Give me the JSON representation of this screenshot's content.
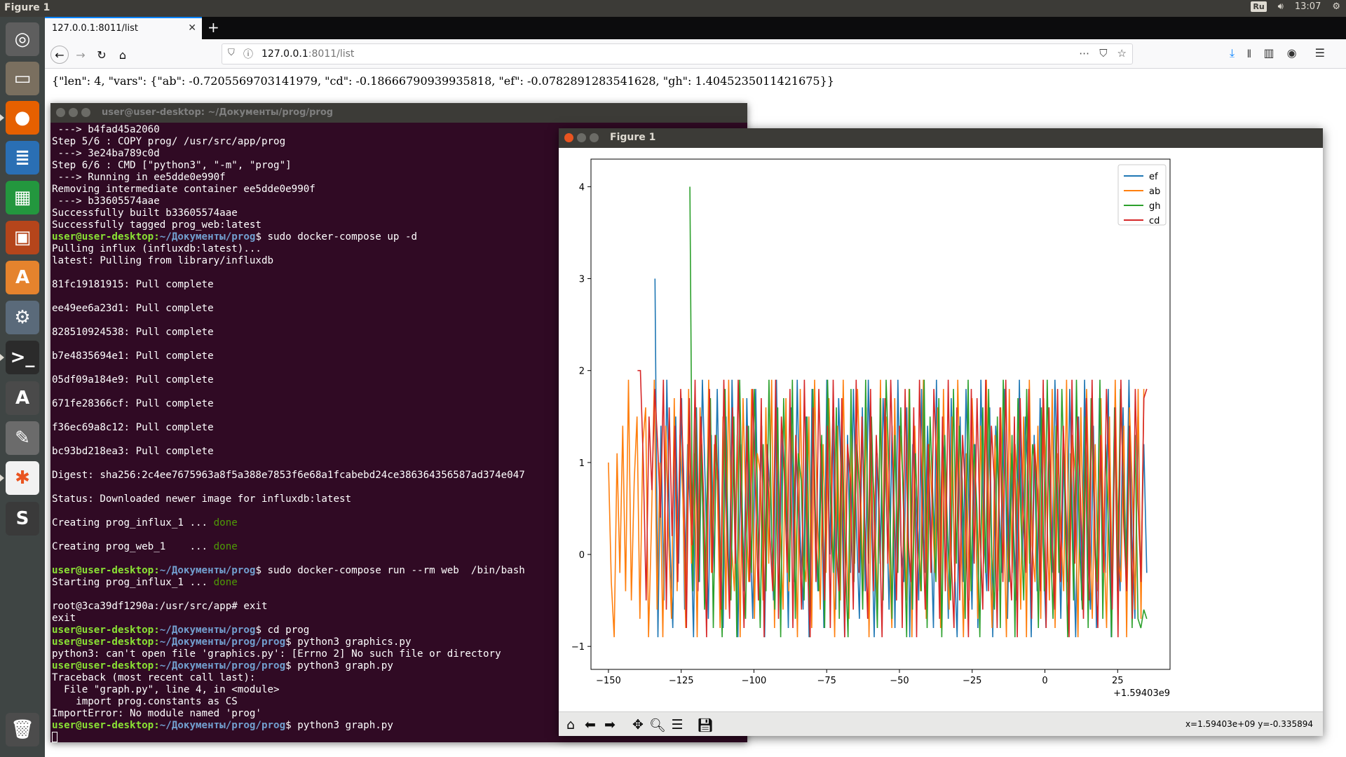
{
  "top_panel": {
    "app_title": "Figure 1",
    "keyboard_layout": "Ru",
    "clock": "13:07"
  },
  "launcher": {
    "items": [
      {
        "name": "ubuntu-dash-icon",
        "color": "#5e5e5e",
        "glyph": "◎"
      },
      {
        "name": "files-icon",
        "color": "#7a6f5f",
        "glyph": "▭"
      },
      {
        "name": "firefox-icon",
        "color": "#e66000",
        "glyph": "●"
      },
      {
        "name": "writer-icon",
        "color": "#2a6fb4",
        "glyph": "≣"
      },
      {
        "name": "calc-icon",
        "color": "#23973e",
        "glyph": "▦"
      },
      {
        "name": "impress-icon",
        "color": "#b5451b",
        "glyph": "▣"
      },
      {
        "name": "software-center-icon",
        "color": "#e5832d",
        "glyph": "A"
      },
      {
        "name": "system-settings-icon",
        "color": "#5a6a7a",
        "glyph": "⚙"
      },
      {
        "name": "terminal-icon",
        "color": "#2b2b2b",
        "glyph": ">_"
      },
      {
        "name": "software-updater-icon",
        "color": "#4a4a4a",
        "glyph": "A"
      },
      {
        "name": "text-editor-icon",
        "color": "#6b6b6b",
        "glyph": "✎"
      },
      {
        "name": "figure-app-icon",
        "color": "#f2f2f2",
        "glyph": "✱"
      },
      {
        "name": "sublime-text-icon",
        "color": "#3a3a3a",
        "glyph": "S"
      },
      {
        "name": "trash-icon",
        "color": "#4c4c4c",
        "glyph": "🗑"
      }
    ]
  },
  "browser": {
    "tab_title": "127.0.0.1:8011/list",
    "url_host": "127.0.0.1",
    "url_path": ":8011/list",
    "page_text": "{\"len\": 4, \"vars\": {\"ab\": -0.7205569703141979, \"cd\": -0.18666790939935818, \"ef\": -0.0782891283541628, \"gh\": 1.4045235011421675}}"
  },
  "terminal": {
    "title": "user@user-desktop: ~/Документы/prog/prog",
    "lines": [
      {
        "t": " ---> b4fad45a2060"
      },
      {
        "t": "Step 5/6 : COPY prog/ /usr/src/app/prog"
      },
      {
        "t": " ---> 3e24ba789c0d"
      },
      {
        "t": "Step 6/6 : CMD [\"python3\", \"-m\", \"prog\"]"
      },
      {
        "t": " ---> Running in ee5dde0e990f"
      },
      {
        "t": "Removing intermediate container ee5dde0e990f"
      },
      {
        "t": " ---> b33605574aae"
      },
      {
        "t": "Successfully built b33605574aae"
      },
      {
        "t": "Successfully tagged prog_web:latest"
      },
      {
        "u": "user@user-desktop",
        "p": "~/Документы/prog",
        "c": "$ sudo docker-compose up -d"
      },
      {
        "t": "Pulling influx (influxdb:latest)..."
      },
      {
        "t": "latest: Pulling from library/influxdb"
      },
      {
        "t": ""
      },
      {
        "t": "81fc19181915: Pull complete"
      },
      {
        "t": ""
      },
      {
        "t": "ee49ee6a23d1: Pull complete"
      },
      {
        "t": ""
      },
      {
        "t": "828510924538: Pull complete"
      },
      {
        "t": ""
      },
      {
        "t": "b7e4835694e1: Pull complete"
      },
      {
        "t": ""
      },
      {
        "t": "05df09a184e9: Pull complete"
      },
      {
        "t": ""
      },
      {
        "t": "671fe28366cf: Pull complete"
      },
      {
        "t": ""
      },
      {
        "t": "f36ec69a8c12: Pull complete"
      },
      {
        "t": ""
      },
      {
        "t": "bc93bd218ea3: Pull complete"
      },
      {
        "t": ""
      },
      {
        "t": "Digest: sha256:2c4ee7675963a8f5a388e7853f6e68a1fcabebd24ce386364356587ad374e047"
      },
      {
        "t": ""
      },
      {
        "t": "Status: Downloaded newer image for influxdb:latest"
      },
      {
        "t": ""
      },
      {
        "t": "Creating prog_influx_1 ... ",
        "d": "done"
      },
      {
        "t": ""
      },
      {
        "t": "Creating prog_web_1    ... ",
        "d": "done"
      },
      {
        "t": ""
      },
      {
        "u": "user@user-desktop",
        "p": "~/Документы/prog",
        "c": "$ sudo docker-compose run --rm web  /bin/bash"
      },
      {
        "t": "Starting prog_influx_1 ... ",
        "d": "done"
      },
      {
        "t": ""
      },
      {
        "t": "root@3ca39df1290a:/usr/src/app# exit"
      },
      {
        "t": "exit"
      },
      {
        "u": "user@user-desktop",
        "p": "~/Документы/prog",
        "c": "$ cd prog"
      },
      {
        "u": "user@user-desktop",
        "p": "~/Документы/prog/prog",
        "c": "$ python3 graphics.py"
      },
      {
        "t": "python3: can't open file 'graphics.py': [Errno 2] No such file or directory"
      },
      {
        "u": "user@user-desktop",
        "p": "~/Документы/prog/prog",
        "c": "$ python3 graph.py"
      },
      {
        "t": "Traceback (most recent call last):"
      },
      {
        "t": "  File \"graph.py\", line 4, in <module>"
      },
      {
        "t": "    import prog.constants as CS"
      },
      {
        "t": "ImportError: No module named 'prog'"
      },
      {
        "u": "user@user-desktop",
        "p": "~/Документы/prog/prog",
        "c": "$ python3 graph.py"
      },
      {
        "cursor": true
      }
    ]
  },
  "figure": {
    "title": "Figure 1",
    "coords_readout": "x=1.59403e+09  y=-0.335894",
    "toolbar": [
      "home-icon",
      "back-icon",
      "forward-icon",
      "pan-icon",
      "zoom-icon",
      "configure-icon",
      "save-icon"
    ]
  },
  "chart_data": {
    "type": "line",
    "xlim": [
      -156,
      43
    ],
    "ylim": [
      -1.25,
      4.3
    ],
    "x_offset_text": "+1.59403e9",
    "xticks": [
      -150,
      -125,
      -100,
      -75,
      -50,
      -25,
      0,
      25
    ],
    "xtick_labels": [
      "−150",
      "−125",
      "−100",
      "−75",
      "−50",
      "−25",
      "0",
      "25"
    ],
    "yticks": [
      -1,
      0,
      1,
      2,
      3,
      4
    ],
    "ytick_labels": [
      "−1",
      "0",
      "1",
      "2",
      "3",
      "4"
    ],
    "legend_position": "top-right",
    "series": [
      {
        "name": "ef",
        "color": "#1f77b4",
        "x_start": -134,
        "x_end": 35,
        "n": 169,
        "values": [
          3.0,
          -0.9,
          1.4,
          -0.5,
          1.9,
          0.2,
          -0.8,
          1.5,
          -0.1,
          1.7,
          -0.6,
          1.2,
          0.4,
          -0.9,
          1.6,
          -0.3,
          1.9,
          0.7,
          -0.7,
          1.3,
          -0.2,
          1.8,
          0.1,
          -0.8,
          1.5,
          -0.5,
          1.9,
          0.5,
          -0.9,
          1.2,
          -0.4,
          1.7,
          0.3,
          -0.7,
          1.8,
          -0.1,
          1.4,
          -0.9,
          1.1,
          0.6,
          -0.5,
          1.9,
          -0.2,
          1.3,
          0.8,
          -0.8,
          1.6,
          -0.3,
          1.9,
          0.2,
          -0.6,
          1.5,
          -0.9,
          1.8,
          0.4,
          -0.4,
          1.2,
          -0.8,
          1.9,
          0.0,
          1.5,
          -0.6,
          1.7,
          0.7,
          -0.9,
          1.3,
          -0.2,
          1.8,
          0.3,
          -0.7,
          1.6,
          -0.4,
          1.9,
          0.5,
          -0.9,
          1.1,
          -0.1,
          1.7,
          0.8,
          -0.6,
          1.4,
          -0.8,
          1.9,
          0.1,
          -0.3,
          1.6,
          -0.9,
          1.2,
          0.6,
          -0.5,
          1.8,
          -0.2,
          1.4,
          0.4,
          -0.8,
          1.9,
          -0.4,
          1.3,
          0.9,
          -0.7,
          1.7,
          0.0,
          -0.9,
          1.5,
          -0.3,
          1.8,
          0.5,
          -0.6,
          1.2,
          -0.8,
          1.9,
          0.2,
          -0.4,
          1.6,
          -0.9,
          1.4,
          0.7,
          -0.2,
          1.8,
          -0.7,
          1.1,
          0.3,
          -0.5,
          1.9,
          -0.1,
          1.5,
          0.8,
          -0.9,
          1.3,
          -0.4,
          1.7,
          0.1,
          -0.8,
          1.6,
          -0.2,
          1.9,
          0.6,
          -0.7,
          1.2,
          -0.3,
          1.8,
          0.4,
          -0.9,
          1.5,
          -0.5,
          1.9,
          0.0,
          -0.6,
          1.4,
          -0.8,
          1.7,
          0.5,
          -0.2,
          1.8,
          -0.9,
          1.3,
          0.7,
          -0.4,
          1.6,
          -0.1,
          1.9,
          0.2,
          -0.7,
          1.5,
          -0.3,
          1.2,
          -0.2
        ]
      },
      {
        "name": "ab",
        "color": "#ff7f0e",
        "x_start": -150,
        "x_end": 34,
        "n": 184,
        "values": [
          1.0,
          -0.3,
          -0.9,
          1.1,
          -0.2,
          1.4,
          -0.4,
          1.9,
          -0.5,
          0.8,
          1.5,
          -0.7,
          1.2,
          1.6,
          -0.9,
          0.3,
          1.9,
          -0.6,
          1.0,
          -0.9,
          1.4,
          0.2,
          -0.7,
          1.7,
          -0.4,
          1.3,
          0.6,
          -0.8,
          1.8,
          -0.1,
          1.1,
          -0.9,
          1.6,
          0.4,
          -0.5,
          1.9,
          -0.2,
          1.2,
          0.8,
          -0.8,
          1.5,
          -0.6,
          1.9,
          0.1,
          -0.4,
          1.3,
          -0.9,
          1.7,
          0.5,
          -0.3,
          1.8,
          -0.7,
          1.1,
          0.9,
          -0.5,
          1.6,
          -0.1,
          1.9,
          -0.8,
          1.2,
          0.3,
          -0.6,
          1.7,
          -0.4,
          1.4,
          0.7,
          -0.9,
          1.8,
          0.0,
          -0.3,
          1.5,
          -0.8,
          1.9,
          0.4,
          -0.6,
          1.2,
          -0.2,
          1.7,
          0.6,
          -0.9,
          1.4,
          -0.5,
          1.9,
          0.2,
          -0.7,
          1.3,
          -0.1,
          1.8,
          0.8,
          -0.4,
          1.6,
          -0.9,
          1.1,
          0.5,
          -0.6,
          1.9,
          -0.3,
          1.5,
          0.1,
          -0.8,
          1.7,
          -0.2,
          1.3,
          0.7,
          -0.5,
          1.8,
          -0.9,
          1.4,
          0.3,
          -0.4,
          1.9,
          -0.7,
          1.2,
          0.6,
          -0.2,
          1.6,
          -0.8,
          1.8,
          0.0,
          -0.6,
          1.5,
          -0.3,
          1.9,
          0.4,
          -0.9,
          1.1,
          -0.5,
          1.7,
          0.8,
          -0.7,
          1.4,
          -0.1,
          1.9,
          0.2,
          -0.8,
          1.3,
          -0.4,
          1.6,
          0.5,
          -0.9,
          1.8,
          -0.2,
          1.2,
          0.7,
          -0.6,
          1.5,
          -0.9,
          1.9,
          0.1,
          -0.3,
          1.4,
          -0.7,
          1.7,
          0.6,
          -0.5,
          1.8,
          -0.8,
          1.1,
          0.3,
          -0.4,
          1.9,
          -0.6,
          1.3,
          0.9,
          -0.9,
          1.6,
          -0.2,
          1.8,
          0.4,
          -0.7,
          1.2,
          -0.4,
          1.7,
          0.2,
          -0.8,
          1.5,
          -0.5,
          1.9,
          0.0,
          -0.3,
          1.4,
          -0.9,
          1.6,
          0.7,
          -0.6,
          1.8,
          -0.7,
          1.8
        ]
      },
      {
        "name": "gh",
        "color": "#2ca02c",
        "x_start": -122,
        "x_end": 35,
        "n": 157,
        "values": [
          4.0,
          -0.4,
          1.6,
          -0.3,
          1.2,
          -0.6,
          0.9,
          1.7,
          -0.8,
          1.3,
          0.4,
          -0.9,
          1.8,
          0.0,
          -0.5,
          1.5,
          -0.9,
          1.9,
          0.3,
          -0.7,
          1.4,
          -0.2,
          1.8,
          0.6,
          -0.8,
          1.2,
          -0.4,
          1.9,
          0.1,
          -0.6,
          1.6,
          -0.9,
          1.7,
          0.5,
          -0.3,
          1.9,
          -0.7,
          1.1,
          0.8,
          -0.5,
          1.5,
          -0.9,
          1.8,
          0.2,
          -0.4,
          1.3,
          -0.8,
          1.9,
          0.6,
          -0.2,
          1.6,
          -0.7,
          1.4,
          0.0,
          -0.9,
          1.8,
          -0.3,
          1.2,
          0.7,
          -0.6,
          1.9,
          -0.1,
          1.5,
          0.3,
          -0.8,
          1.7,
          -0.5,
          1.9,
          0.9,
          -0.7,
          1.3,
          -0.2,
          1.6,
          0.4,
          -0.9,
          1.8,
          -0.6,
          1.1,
          0.1,
          -0.4,
          1.9,
          -0.8,
          1.5,
          0.6,
          -0.3,
          1.7,
          -0.9,
          1.3,
          0.2,
          -0.5,
          1.8,
          -0.1,
          1.4,
          0.8,
          -0.7,
          1.9,
          -0.4,
          1.2,
          0.5,
          -0.9,
          1.6,
          -0.2,
          1.8,
          0.0,
          -0.6,
          1.5,
          -0.8,
          1.9,
          0.7,
          -0.3,
          1.3,
          -0.9,
          1.7,
          0.4,
          -0.5,
          1.8,
          -0.1,
          1.2,
          0.9,
          -0.8,
          1.6,
          -0.4,
          1.9,
          0.3,
          -0.7,
          1.4,
          -0.2,
          1.8,
          0.6,
          -0.9,
          1.1,
          -0.5,
          1.9,
          0.1,
          -0.6,
          1.5,
          -0.8,
          1.7,
          0.5,
          -0.3,
          1.9,
          -0.7,
          1.2,
          0.2,
          -0.9,
          1.6,
          -0.4,
          1.8,
          0.8,
          -0.2,
          1.4,
          -0.8,
          1.3,
          -0.7,
          -0.8,
          -0.6,
          -0.7
        ]
      },
      {
        "name": "cd",
        "color": "#d62728",
        "x_start": -140,
        "x_end": 35,
        "n": 175,
        "values": [
          2.0,
          2.0,
          1.0,
          -0.5,
          1.5,
          0.7,
          1.8,
          1.2,
          0.4,
          1.9,
          -0.6,
          1.6,
          0.2,
          1.4,
          -0.3,
          1.8,
          0.9,
          -0.8,
          1.7,
          0.1,
          1.9,
          -0.4,
          1.5,
          0.6,
          -0.9,
          1.8,
          -0.2,
          1.3,
          0.8,
          -0.6,
          1.9,
          0.3,
          -0.7,
          1.6,
          -0.1,
          1.9,
          0.5,
          -0.8,
          1.4,
          -0.3,
          1.8,
          0.7,
          -0.5,
          1.7,
          -0.9,
          1.2,
          0.2,
          -0.4,
          1.9,
          -0.7,
          1.5,
          0.9,
          -0.2,
          1.8,
          -0.8,
          1.3,
          0.4,
          -0.6,
          1.9,
          0.0,
          -0.9,
          1.6,
          -0.3,
          1.8,
          0.6,
          -0.5,
          1.4,
          -0.8,
          1.9,
          0.1,
          -0.4,
          1.7,
          -0.9,
          1.2,
          0.8,
          -0.6,
          1.9,
          -0.2,
          1.5,
          0.3,
          -0.7,
          1.8,
          -0.4,
          1.3,
          0.5,
          -0.9,
          1.7,
          -0.1,
          1.9,
          0.7,
          -0.5,
          1.4,
          -0.8,
          1.8,
          0.2,
          -0.3,
          1.6,
          -0.9,
          1.9,
          0.4,
          -0.6,
          1.2,
          -0.2,
          1.8,
          0.9,
          -0.7,
          1.5,
          -0.4,
          1.9,
          0.0,
          -0.8,
          1.6,
          -0.5,
          1.3,
          0.6,
          -0.9,
          1.8,
          -0.1,
          1.7,
          0.3,
          -0.6,
          1.9,
          -0.4,
          1.4,
          0.8,
          -0.8,
          1.6,
          -0.3,
          1.9,
          0.1,
          -0.5,
          1.5,
          -0.9,
          1.7,
          0.5,
          -0.2,
          1.8,
          -0.7,
          1.2,
          0.7,
          -0.4,
          1.9,
          -0.8,
          1.6,
          0.2,
          -0.6,
          1.8,
          -0.3,
          1.4,
          0.4,
          -0.9,
          1.9,
          -0.1,
          1.5,
          0.6,
          -0.7,
          1.7,
          -0.5,
          1.9,
          0.0,
          -0.8,
          1.3,
          -0.2,
          1.8,
          0.8,
          -0.6,
          1.6,
          -0.9,
          1.9,
          0.3,
          -0.4,
          1.4,
          -0.7,
          1.8,
          0.5,
          -0.3,
          1.7,
          1.8
        ]
      }
    ]
  }
}
